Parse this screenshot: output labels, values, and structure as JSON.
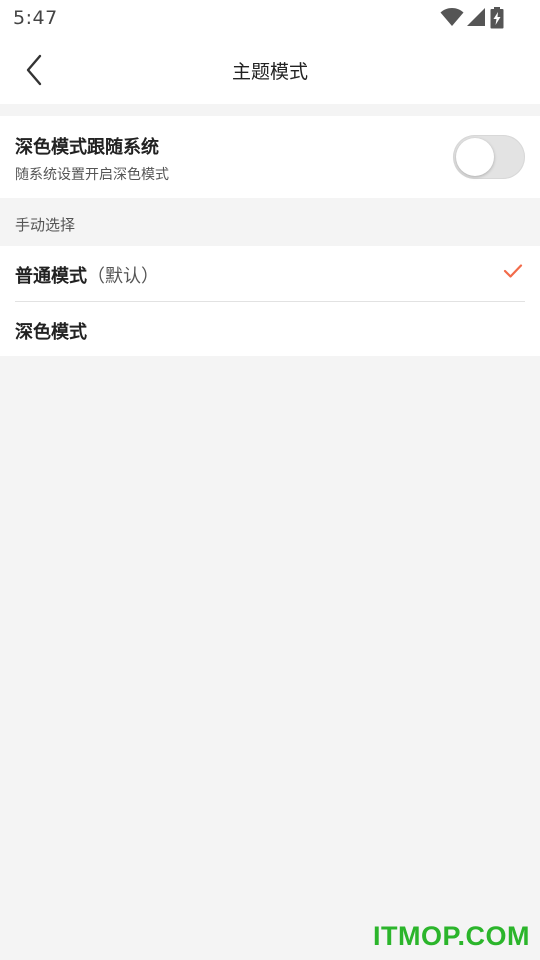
{
  "status_bar": {
    "time": "5:47",
    "icons": [
      "wifi-icon",
      "signal-icon",
      "battery-charging-icon"
    ]
  },
  "nav": {
    "back_icon": "chevron-left-icon",
    "title": "主题模式"
  },
  "follow_system": {
    "title": "深色模式跟随系统",
    "subtitle": "随系统设置开启深色模式",
    "enabled": false
  },
  "manual_section": {
    "label": "手动选择",
    "options": [
      {
        "label": "普通模式",
        "suffix": "（默认）",
        "selected": true
      },
      {
        "label": "深色模式",
        "suffix": "",
        "selected": false
      }
    ]
  },
  "watermark": "ITMOP.COM",
  "colors": {
    "accent": "#f26b4a",
    "background": "#f4f4f4",
    "card": "#ffffff",
    "toggle_off": "#e3e3e3",
    "watermark": "#2bb52b"
  }
}
